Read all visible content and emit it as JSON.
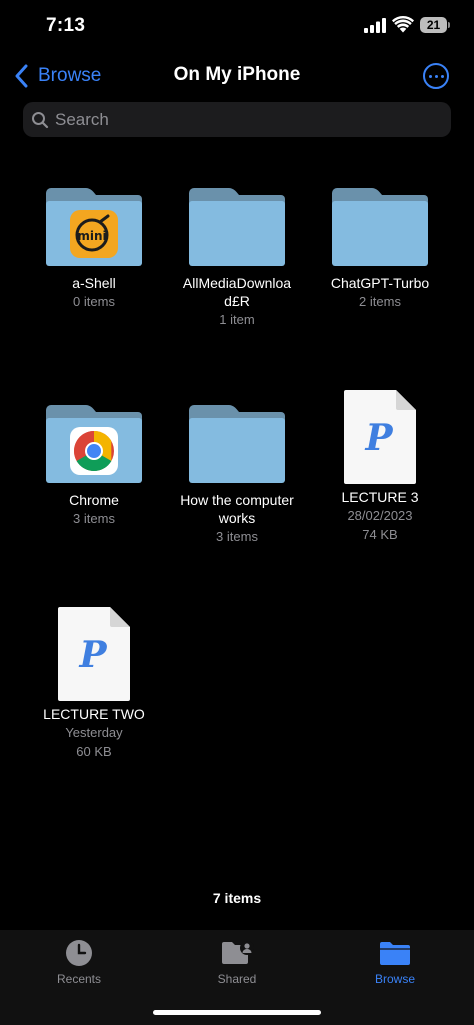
{
  "status": {
    "time": "7:13",
    "battery": "21"
  },
  "nav": {
    "back_label": "Browse",
    "title": "On My iPhone"
  },
  "search": {
    "placeholder": "Search"
  },
  "items": [
    {
      "name": "a-Shell",
      "sub1": "0 items",
      "sub2": "",
      "type": "folder",
      "badge": "a-shell-mini-icon"
    },
    {
      "name": "AllMediaDownloa d£R",
      "sub1": "1 item",
      "sub2": "",
      "type": "folder"
    },
    {
      "name": "ChatGPT-Turbo",
      "sub1": "2 items",
      "sub2": "",
      "type": "folder"
    },
    {
      "name": "Chrome",
      "sub1": "3 items",
      "sub2": "",
      "type": "folder",
      "badge": "chrome-icon"
    },
    {
      "name": "How the computer works",
      "sub1": "3 items",
      "sub2": "",
      "type": "folder"
    },
    {
      "name": "LECTURE 3",
      "sub1": "28/02/2023",
      "sub2": "74 KB",
      "type": "pages-document"
    },
    {
      "name": "LECTURE TWO",
      "sub1": "Yesterday",
      "sub2": "60 KB",
      "type": "pages-document"
    }
  ],
  "footer": {
    "count": "7 items"
  },
  "tabs": [
    {
      "label": "Recents",
      "icon": "clock-icon",
      "active": false
    },
    {
      "label": "Shared",
      "icon": "shared-folder-icon",
      "active": false
    },
    {
      "label": "Browse",
      "icon": "folder-icon",
      "active": true
    }
  ],
  "colors": {
    "accent": "#3a82f7",
    "folder_front": "#84bbe0",
    "folder_back": "#6a91ab",
    "secondary_text": "#8e8e93"
  }
}
